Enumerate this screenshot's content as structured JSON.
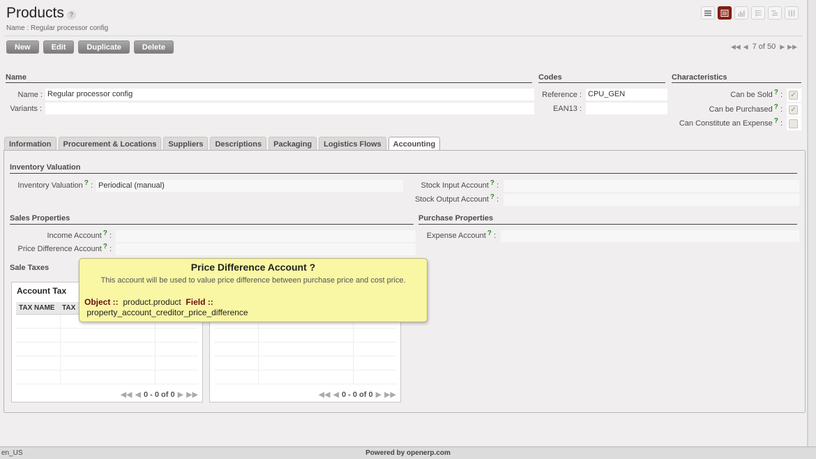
{
  "header": {
    "title": "Products",
    "help": "?",
    "subtitle": "Name : Regular processor config"
  },
  "view_switch": [
    "list-view-icon",
    "form-view-icon",
    "graph-view-icon",
    "calendar-view-icon",
    "gantt-view-icon",
    "kanban-view-icon"
  ],
  "toolbar": {
    "new_label": "New",
    "edit_label": "Edit",
    "duplicate_label": "Duplicate",
    "delete_label": "Delete"
  },
  "pager": {
    "text": "7 of 50"
  },
  "groups": {
    "name": {
      "title": "Name",
      "name_label": "Name :",
      "name_value": "Regular processor config",
      "variants_label": "Variants :",
      "variants_value": ""
    },
    "codes": {
      "title": "Codes",
      "reference_label": "Reference :",
      "reference_value": "CPU_GEN",
      "ean13_label": "EAN13 :",
      "ean13_value": ""
    },
    "characteristics": {
      "title": "Characteristics",
      "can_be_sold": "Can be Sold",
      "can_be_purchased": "Can be Purchased",
      "can_constitute_expense": "Can Constitute an Expense",
      "q": "?",
      "colon": ":",
      "can_be_sold_checked": true,
      "can_be_purchased_checked": true,
      "can_constitute_expense_checked": false
    }
  },
  "tabs": [
    "Information",
    "Procurement & Locations",
    "Suppliers",
    "Descriptions",
    "Packaging",
    "Logistics Flows",
    "Accounting"
  ],
  "active_tab": "Accounting",
  "accounting": {
    "inventory_valuation_title": "Inventory Valuation",
    "inventory_valuation_label": "Inventory Valuation",
    "inventory_valuation_value": "Periodical (manual)",
    "stock_input_label": "Stock Input Account",
    "stock_output_label": "Stock Output Account",
    "sales_properties_title": "Sales Properties",
    "income_account_label": "Income Account",
    "price_difference_label": "Price Difference Account",
    "purchase_properties_title": "Purchase Properties",
    "expense_account_label": "Expense Account",
    "sale_taxes_title": "Sale Taxes",
    "q": "?",
    "colon": ":"
  },
  "account_tax_table": {
    "title": "Account Tax",
    "columns": [
      "TAX NAME",
      "TAX"
    ],
    "pager": "0 - 0 of 0"
  },
  "purchase_tax_table": {
    "pager": "0 - 0 of 0"
  },
  "tooltip": {
    "title": "Price Difference Account ?",
    "description": "This account will be used to value price difference between purchase price and cost price.",
    "object_label": "Object ::",
    "object_value": "product.product",
    "field_label": "Field ::",
    "field_value": "property_account_creditor_price_difference"
  },
  "footer": {
    "lang": "en_US",
    "powered": "Powered by openerp.com"
  }
}
